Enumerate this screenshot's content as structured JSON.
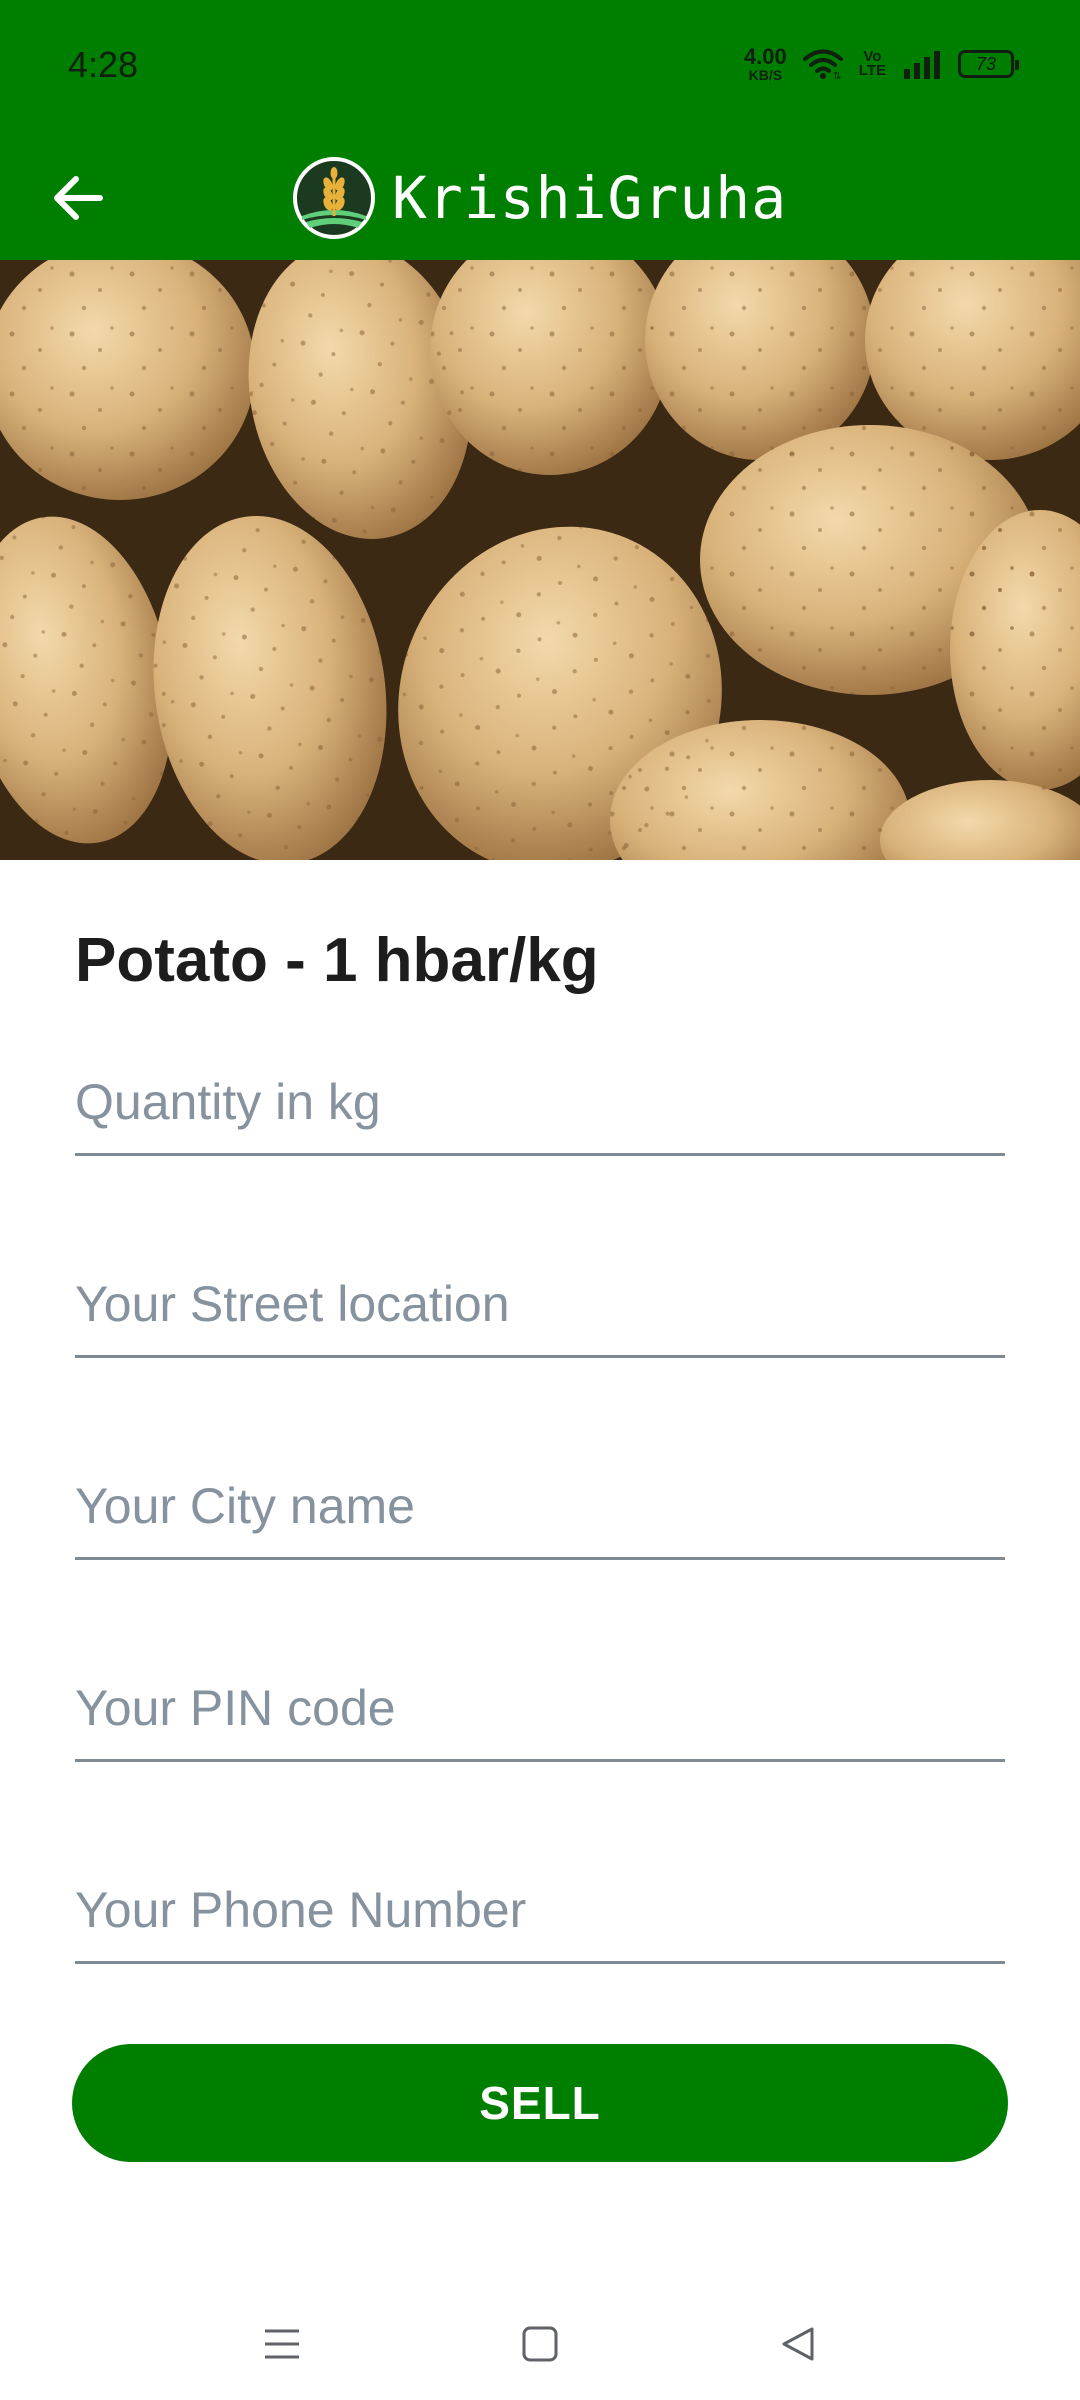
{
  "status_bar": {
    "time": "4:28",
    "net_speed_value": "4.00",
    "net_speed_unit": "KB/S",
    "volte_top": "Vo",
    "volte_bottom": "LTE",
    "battery": "73",
    "icons": [
      "wifi-icon",
      "volte-icon",
      "signal-icon",
      "battery-icon"
    ]
  },
  "app_bar": {
    "title": "KrishiGruha",
    "back_icon": "arrow-left-icon",
    "logo_icon": "wheat-logo-icon",
    "color": "#007E00"
  },
  "product": {
    "image": "potatoes-photo",
    "title": "Potato - 1 hbar/kg"
  },
  "form": {
    "quantity_placeholder": "Quantity in kg",
    "street_placeholder": "Your Street location",
    "city_placeholder": "Your City name",
    "pin_placeholder": "Your PIN code",
    "phone_placeholder": "Your Phone Number",
    "submit_label": "SELL"
  },
  "nav_bar": {
    "icons": [
      "menu-icon",
      "home-square-icon",
      "back-triangle-icon"
    ]
  }
}
